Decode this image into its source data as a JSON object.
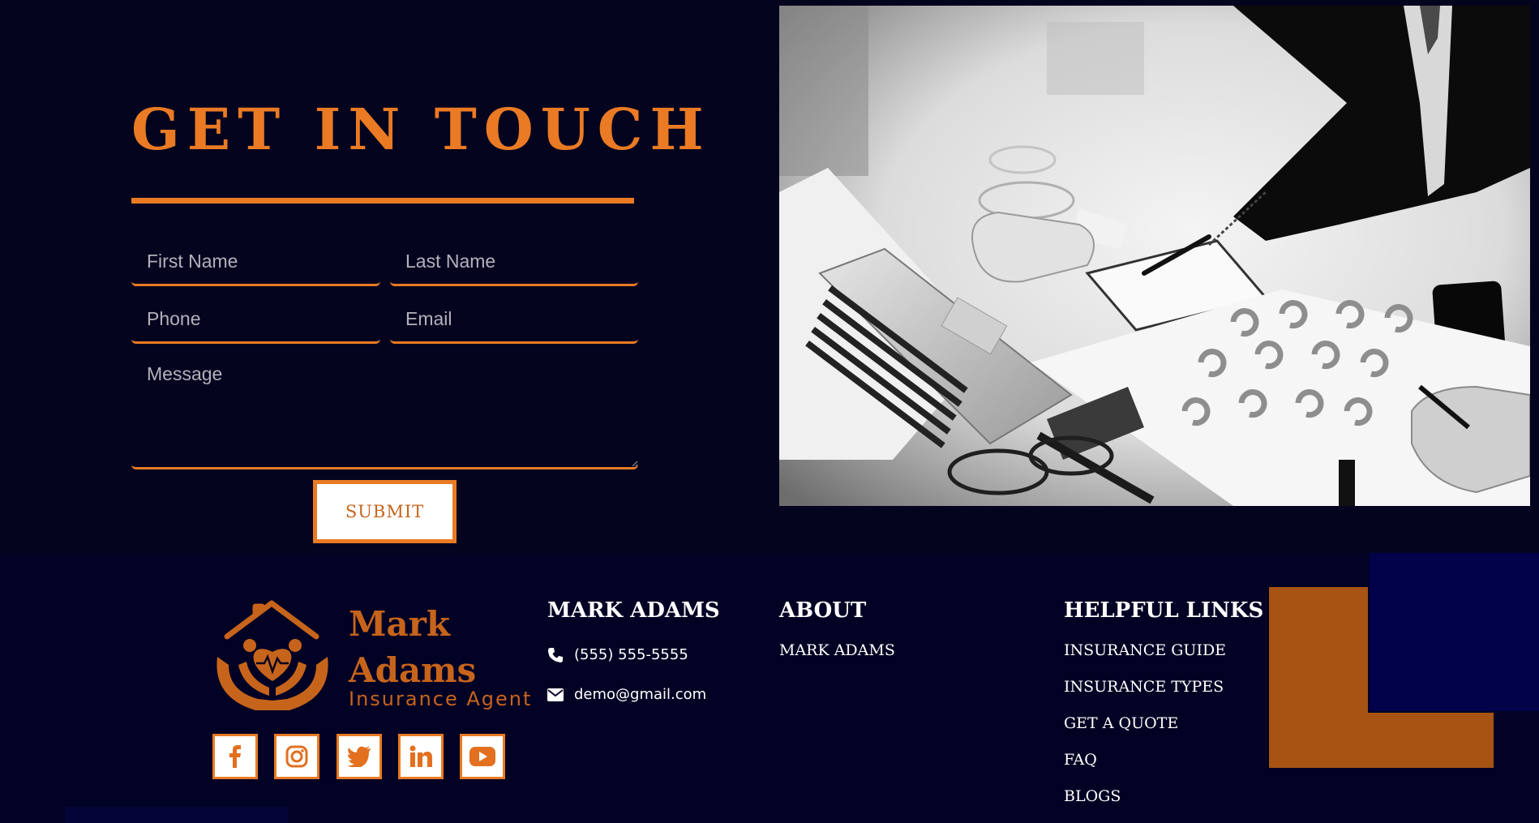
{
  "contact": {
    "title": "GET IN TOUCH",
    "fields": {
      "first_name_placeholder": "First Name",
      "last_name_placeholder": "Last Name",
      "phone_placeholder": "Phone",
      "email_placeholder": "Email",
      "message_placeholder": "Message"
    },
    "submit_label": "SUBMIT"
  },
  "footer": {
    "logo": {
      "line1": "Mark",
      "line2": "Adams",
      "tagline": "Insurance Agent"
    },
    "social": [
      "facebook-icon",
      "instagram-icon",
      "twitter-icon",
      "linkedin-icon",
      "youtube-icon"
    ],
    "mark_adams": {
      "heading": "MARK ADAMS",
      "phone": "(555) 555-5555",
      "email": "demo@gmail.com"
    },
    "about": {
      "heading": "ABOUT",
      "links": [
        "MARK ADAMS"
      ]
    },
    "helpful_links": {
      "heading": "HELPFUL LINKS",
      "links": [
        "INSURANCE GUIDE",
        "INSURANCE TYPES",
        "GET A QUOTE",
        "FAQ",
        "BLOGS"
      ]
    }
  },
  "colors": {
    "background": "#04041f",
    "footer_background": "#020224",
    "accent": "#ea7a24",
    "logo_orange": "#c7641c",
    "deco_orange": "#a65313",
    "deco_navy": "#02024a"
  }
}
